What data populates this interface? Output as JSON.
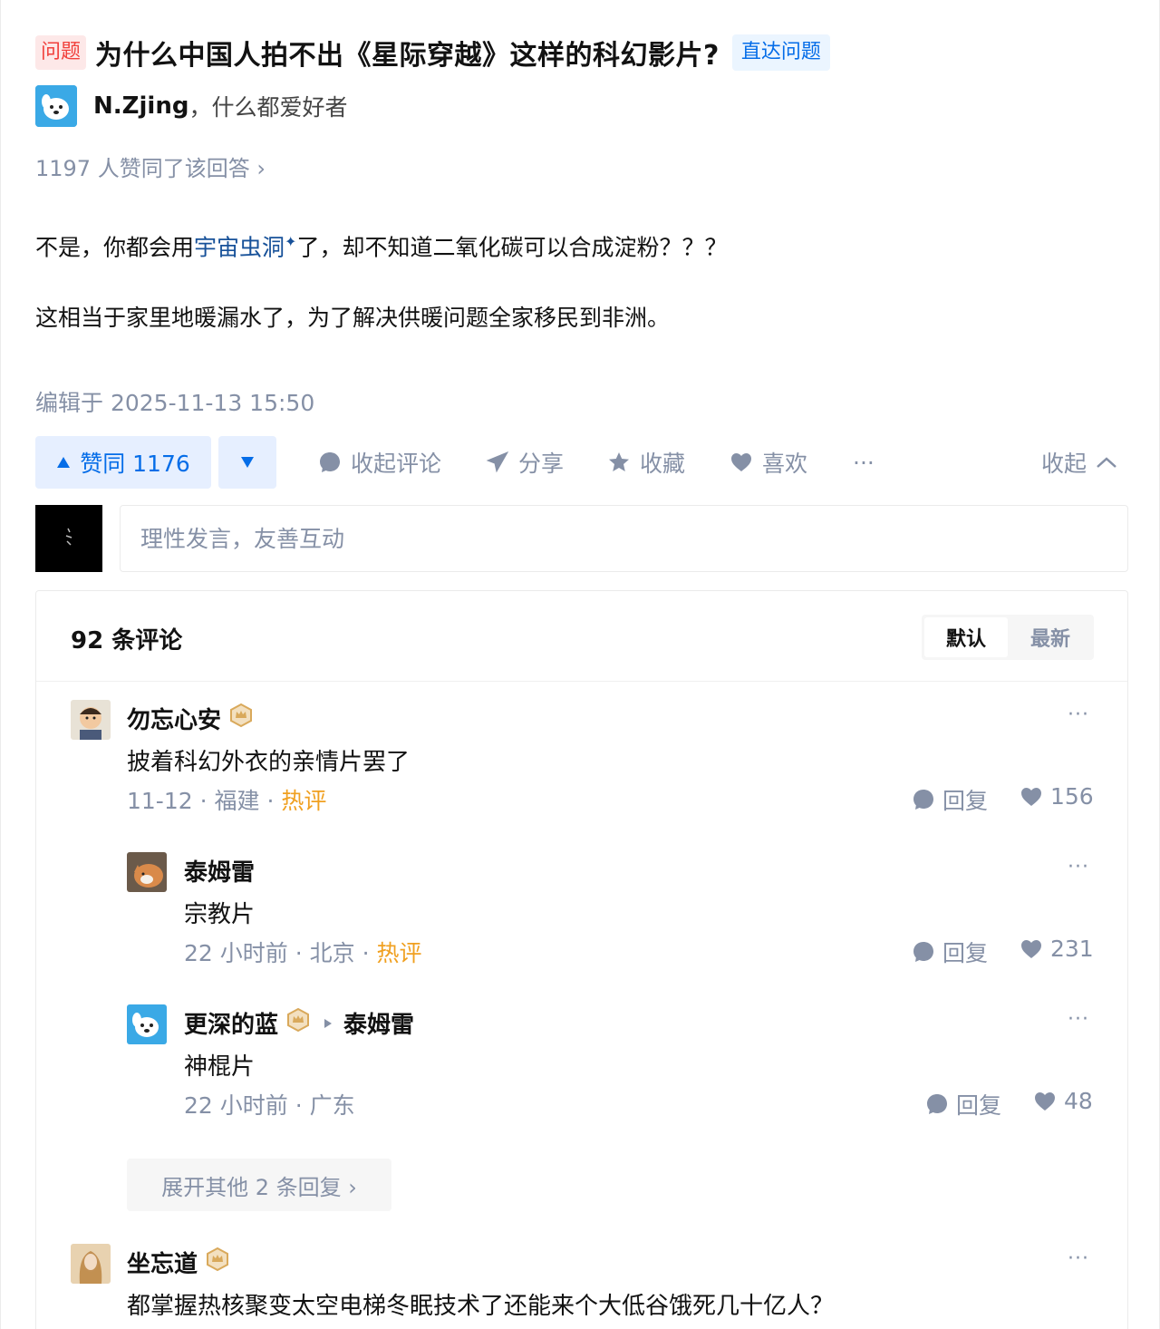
{
  "question": {
    "tag": "问题",
    "title": "为什么中国人拍不出《星际穿越》这样的科幻影片?",
    "jump_label": "直达问题"
  },
  "author": {
    "name": "N.Zjing",
    "bio": "，什么都爱好者",
    "avatar_icon": "dog-avatar"
  },
  "votes_summary": "1197 人赞同了该回答 ›",
  "answer": {
    "p1_before": "不是，你都会用",
    "p1_link": "宇宙虫洞",
    "p1_after": "了，却不知道二氧化碳可以合成淀粉？？？",
    "p2": "这相当于家里地暖漏水了，为了解决供暖问题全家移民到非洲。",
    "edited": "编辑于 2025-11-13 15:50"
  },
  "actions": {
    "upvote_label": "赞同 1176",
    "collapse_comments": "收起评论",
    "share": "分享",
    "favorite": "收藏",
    "like": "喜欢",
    "more": "···",
    "collapse": "收起"
  },
  "comment_input": {
    "placeholder": "理性发言，友善互动"
  },
  "comments_panel": {
    "count_label": "92 条评论",
    "sort_default": "默认",
    "sort_latest": "最新",
    "expand_label": "展开其他 2 条回复 ›"
  },
  "comments": [
    {
      "name": "勿忘心安",
      "text": "披着科幻外衣的亲情片罢了",
      "date": "11-12",
      "location": "福建",
      "hot": "热评",
      "reply": "回复",
      "likes": "156"
    },
    {
      "name": "泰姆雷",
      "text": "宗教片",
      "date": "22 小时前",
      "location": "北京",
      "hot": "热评",
      "reply": "回复",
      "likes": "231"
    },
    {
      "name": "更深的蓝",
      "reply_to": "泰姆雷",
      "text": "神棍片",
      "date": "22 小时前",
      "location": "广东",
      "reply": "回复",
      "likes": "48"
    },
    {
      "name": "坐忘道",
      "text": "都掌握热核聚变太空电梯冬眠技术了还能来个大低谷饿死几十亿人？"
    }
  ],
  "colors": {
    "brand_blue": "#056de8",
    "hot_orange": "#f0a020",
    "question_tag_red": "#f1403c",
    "muted_text": "#8590a6",
    "link": "#175199"
  }
}
